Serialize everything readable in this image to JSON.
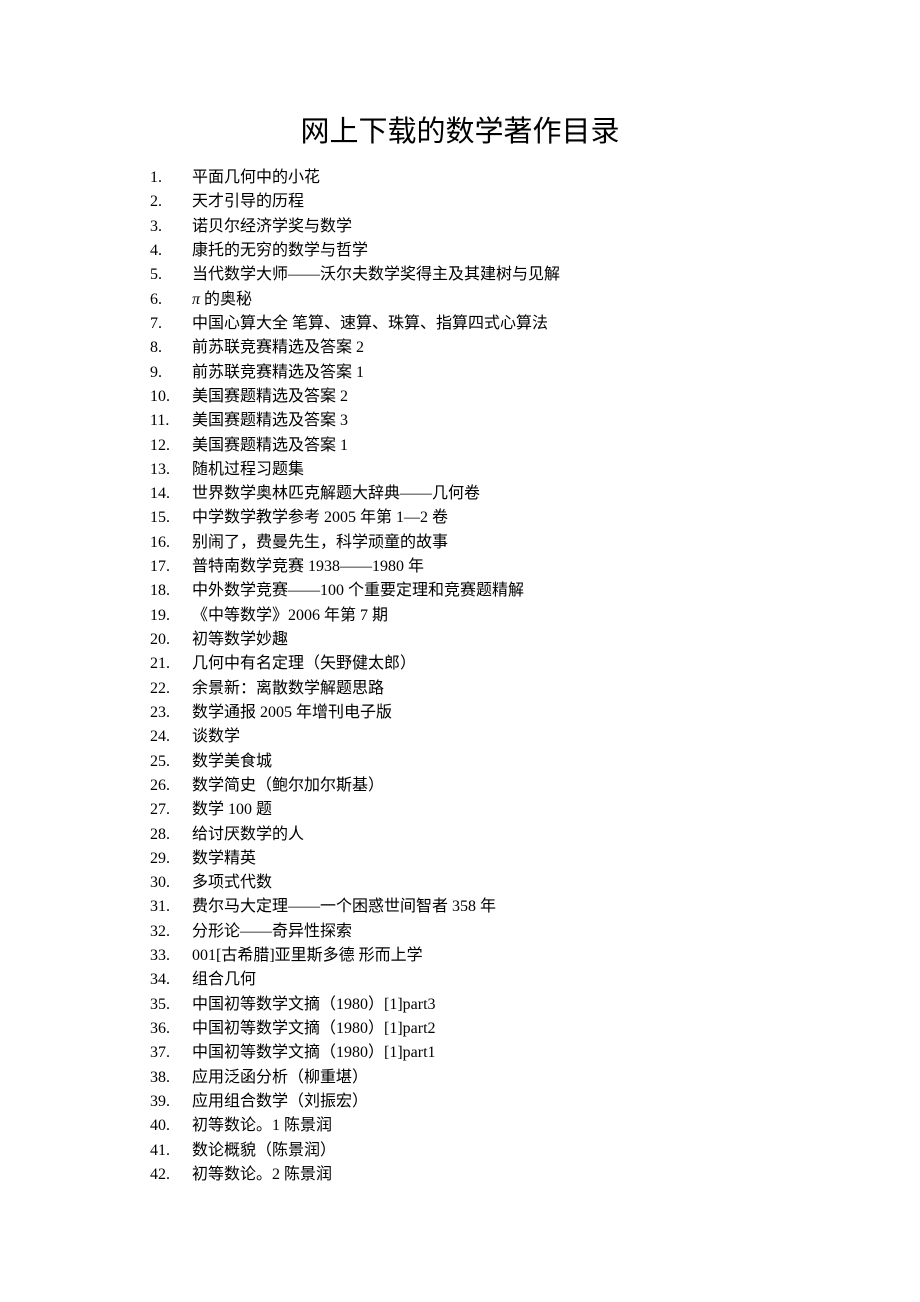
{
  "title": "网上下载的数学著作目录",
  "items": [
    "平面几何中的小花",
    "天才引导的历程",
    "诺贝尔经济学奖与数学",
    "康托的无穷的数学与哲学",
    "当代数学大师——沃尔夫数学奖得主及其建树与见解",
    "π 的奥秘",
    "中国心算大全 笔算、速算、珠算、指算四式心算法",
    "前苏联竞赛精选及答案 2",
    "前苏联竞赛精选及答案 1",
    "美国赛题精选及答案 2",
    "美国赛题精选及答案 3",
    "美国赛题精选及答案 1",
    "随机过程习题集",
    "世界数学奥林匹克解题大辞典——几何卷",
    "中学数学教学参考 2005 年第 1—2 卷",
    "别闹了，费曼先生，科学顽童的故事",
    "普特南数学竞赛 1938——1980 年",
    "中外数学竞赛——100 个重要定理和竞赛题精解",
    "《中等数学》2006 年第 7 期",
    "初等数学妙趣",
    "几何中有名定理（矢野健太郎）",
    "余景新：离散数学解题思路",
    "数学通报 2005 年增刊电子版",
    "谈数学",
    "数学美食城",
    "数学简史（鲍尔加尔斯基）",
    "数学 100 题",
    "给讨厌数学的人",
    "数学精英",
    "多项式代数",
    "费尔马大定理——一个困惑世间智者 358 年",
    "分形论——奇异性探索",
    "001[古希腊]亚里斯多德 形而上学",
    "组合几何",
    "中国初等数学文摘（1980）[1]part3",
    "中国初等数学文摘（1980）[1]part2",
    "中国初等数学文摘（1980）[1]part1",
    "应用泛函分析（柳重堪）",
    "应用组合数学（刘振宏）",
    "初等数论。1 陈景润",
    "数论概貌（陈景润）",
    "初等数论。2 陈景润"
  ]
}
